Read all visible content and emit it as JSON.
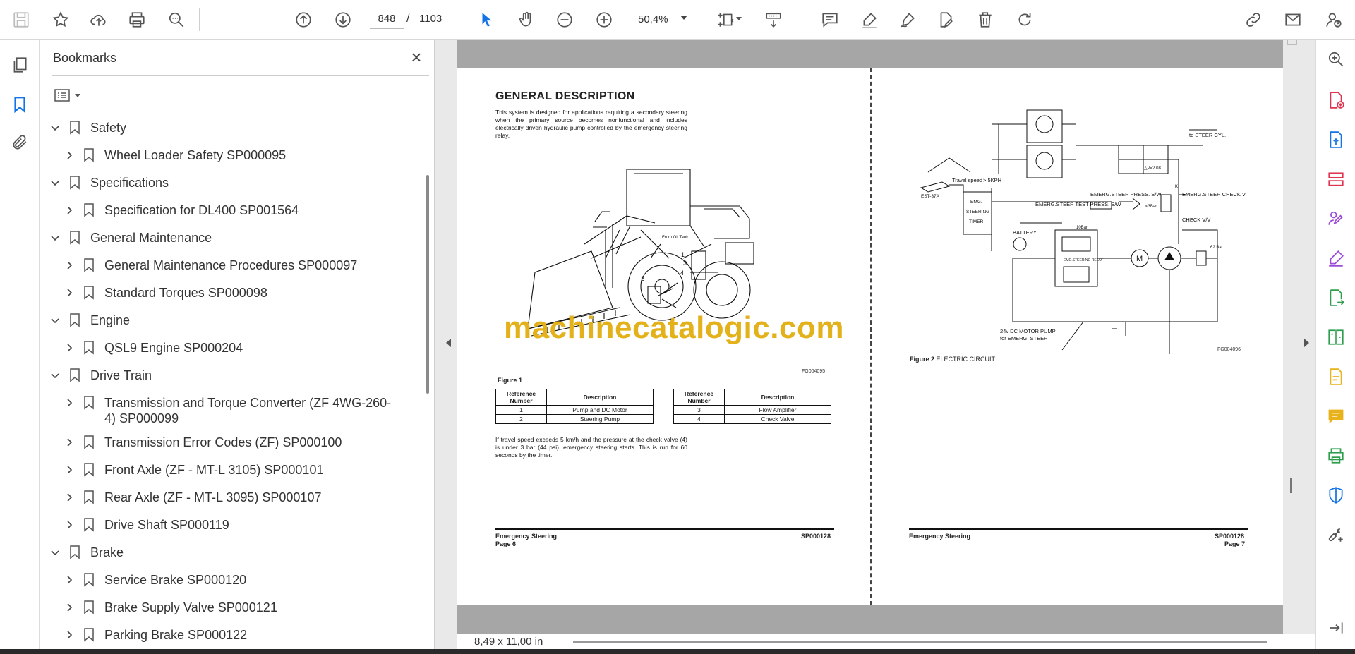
{
  "toolbar": {
    "page_current": "848",
    "page_separator": "/",
    "page_total": "1103",
    "zoom": "50,4%"
  },
  "bookmarks": {
    "title": "Bookmarks",
    "items": [
      {
        "level": 1,
        "expanded": true,
        "label": "Safety"
      },
      {
        "level": 2,
        "expanded": false,
        "label": "Wheel Loader Safety SP000095"
      },
      {
        "level": 1,
        "expanded": true,
        "label": "Specifications"
      },
      {
        "level": 2,
        "expanded": false,
        "label": "Specification for DL400 SP001564"
      },
      {
        "level": 1,
        "expanded": true,
        "label": "General Maintenance"
      },
      {
        "level": 2,
        "expanded": false,
        "label": "General Maintenance Procedures SP000097"
      },
      {
        "level": 2,
        "expanded": false,
        "label": "Standard Torques SP000098"
      },
      {
        "level": 1,
        "expanded": true,
        "label": "Engine"
      },
      {
        "level": 2,
        "expanded": false,
        "label": "QSL9 Engine SP000204"
      },
      {
        "level": 1,
        "expanded": true,
        "label": "Drive Train"
      },
      {
        "level": 2,
        "expanded": false,
        "label": "Transmission and Torque Converter (ZF 4WG-260-4) SP000099"
      },
      {
        "level": 2,
        "expanded": false,
        "label": "Transmission Error Codes (ZF) SP000100"
      },
      {
        "level": 2,
        "expanded": false,
        "label": "Front Axle (ZF - MT-L 3105) SP000101"
      },
      {
        "level": 2,
        "expanded": false,
        "label": "Rear Axle (ZF - MT-L 3095) SP000107"
      },
      {
        "level": 2,
        "expanded": false,
        "label": "Drive Shaft SP000119"
      },
      {
        "level": 1,
        "expanded": true,
        "label": "Brake"
      },
      {
        "level": 2,
        "expanded": false,
        "label": "Service Brake SP000120"
      },
      {
        "level": 2,
        "expanded": false,
        "label": "Brake Supply Valve SP000121"
      },
      {
        "level": 2,
        "expanded": false,
        "label": "Parking Brake SP000122"
      }
    ]
  },
  "document": {
    "left": {
      "title": "GENERAL DESCRIPTION",
      "intro": "This system is designed for applications requiring a secondary steering when the primary source becomes nonfunctional and includes electrically driven hydraulic pump controlled by the emergency steering relay.",
      "figure_code": "FG004095",
      "figure_label": "Figure 1",
      "table_headers": [
        "Reference Number",
        "Description"
      ],
      "table_left": [
        [
          "1",
          "Pump and DC Motor"
        ],
        [
          "2",
          "Steering Pump"
        ]
      ],
      "table_right": [
        [
          "3",
          "Flow Amplifier"
        ],
        [
          "4",
          "Check Valve"
        ]
      ],
      "body": "If travel speed exceeds 5 km/h and the pressure at the check valve (4) is under 3 bar (44 psi), emergency steering starts. This is run for 60 seconds by the timer.",
      "callout_tank": "From Oil Tank",
      "callout_numbers": [
        "1",
        "2",
        "3",
        "4"
      ],
      "footer_title": "Emergency Steering",
      "footer_page": "Page 6",
      "footer_code": "SP000128"
    },
    "right": {
      "figure_code": "FG004096",
      "figure_label": "Figure 2",
      "figure_caption": "ELECTRIC CIRCUIT",
      "labels": {
        "to_steer": "to STEER CYL.",
        "travel_speed": "Travel speed",
        "speed_value": "> 5KPH",
        "est": "EST-37A",
        "test_sw": "EMERG.STEER TEST PRESS. S/W",
        "press_sw": "EMERG.STEER PRESS. S/W",
        "check_vv": "EMERG.STEER CHECK V/V",
        "check_vv2": "CHECK V/V",
        "timer1": "EMG.",
        "timer2": "STEERING",
        "timer3": "TIMER",
        "battery": "BATTERY",
        "relay": "EMG.STEERING RELAY",
        "motor": "M",
        "pump_note": "24v DC MOTOR PUMP",
        "pump_note2": "for EMERG. STEER",
        "bar3": "<3Bar",
        "bar10": "10Bar",
        "bar62": "62 Bar",
        "pv": "△P=2.08",
        "k": "K"
      },
      "footer_title": "Emergency Steering",
      "footer_page": "Page 7",
      "footer_code": "SP000128"
    }
  },
  "watermark": "machinecatalogic.com",
  "status": {
    "page_size": "8,49 x 11,00 in"
  },
  "colors": {
    "accent_blue": "#1473e6",
    "pink_tool": "#e0334f",
    "purple_tool": "#9b4bd8",
    "green_tool": "#2d9d4e",
    "yellow_tool": "#e8b21c",
    "watermark": "#e3b11a"
  }
}
